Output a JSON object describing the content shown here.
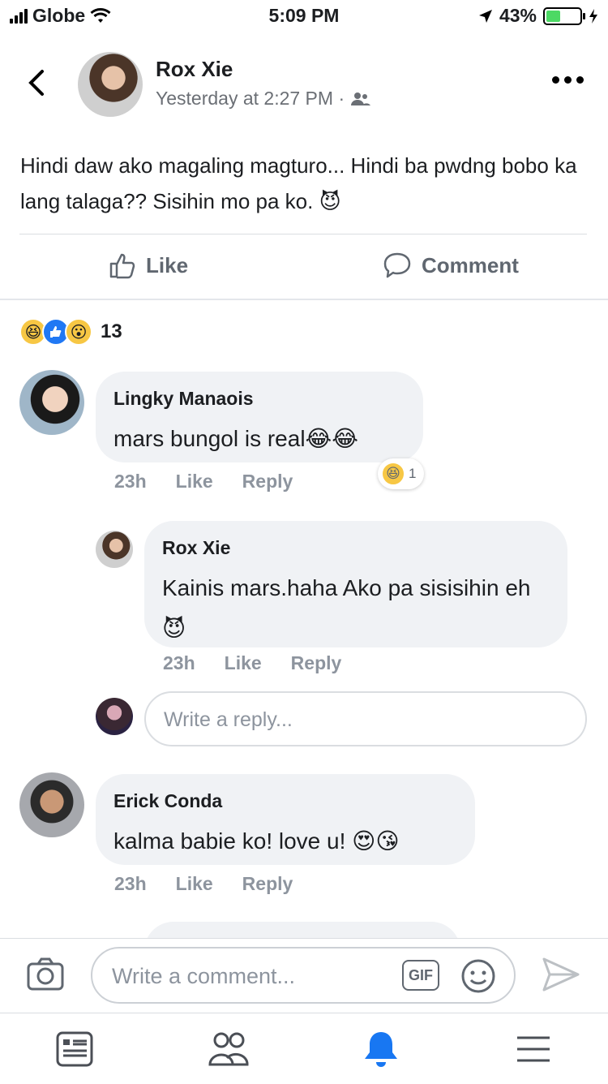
{
  "status_bar": {
    "carrier": "Globe",
    "time": "5:09 PM",
    "battery": "43%",
    "battery_level": 0.43
  },
  "post": {
    "author": "Rox Xie",
    "timestamp": "Yesterday at 2:27 PM ·",
    "text": "Hindi daw ako magaling magturo... Hindi ba pwdng bobo ka lang talaga?? Sisihin mo pa ko. 😈",
    "like_label": "Like",
    "comment_label": "Comment",
    "reaction_count": "13"
  },
  "comments": [
    {
      "name": "Lingky Manaois",
      "text": "mars bungol is real😂😂",
      "time": "23h",
      "like": "Like",
      "reply": "Reply",
      "reaction_count": "1",
      "replies": [
        {
          "name": "Rox Xie",
          "text": "Kainis mars.haha Ako pa sisisihin eh 😈",
          "time": "23h",
          "like": "Like",
          "reply": "Reply"
        }
      ],
      "reply_placeholder": "Write a reply..."
    },
    {
      "name": "Erick Conda",
      "text": "kalma babie ko! love u! 😍😘",
      "time": "23h",
      "like": "Like",
      "reply": "Reply"
    }
  ],
  "composer": {
    "placeholder": "Write a comment...",
    "gif_label": "GIF"
  },
  "colors": {
    "brand": "#1877f2",
    "bubble": "#f0f2f5",
    "muted": "#8d949e"
  }
}
